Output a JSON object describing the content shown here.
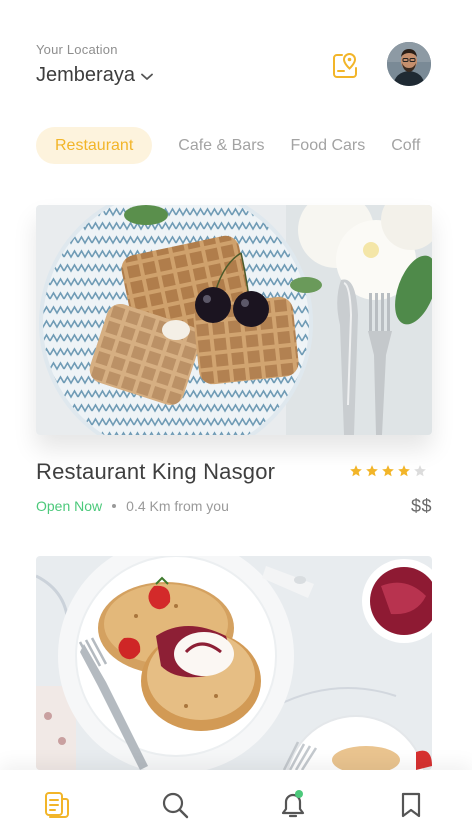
{
  "header": {
    "location_label": "Your Location",
    "location_value": "Jemberaya"
  },
  "tabs": [
    {
      "label": "Restaurant",
      "active": true
    },
    {
      "label": "Cafe & Bars",
      "active": false
    },
    {
      "label": "Food Cars",
      "active": false
    },
    {
      "label": "Coff",
      "active": false
    }
  ],
  "restaurants": [
    {
      "name": "Restaurant King Nasgor",
      "rating": 4,
      "rating_max": 5,
      "status": "Open Now",
      "distance": "0.4 Km from you",
      "price": "$$"
    }
  ],
  "colors": {
    "accent": "#f2b529",
    "accent_bg": "#fdf3dd",
    "open_green": "#4cc97b",
    "star_empty": "#dcdcdc"
  },
  "icons": {
    "header": [
      "chevron-down-icon",
      "map-pin-icon",
      "avatar"
    ],
    "nav": [
      "menu-doc-icon",
      "search-icon",
      "bell-icon",
      "bookmark-icon"
    ]
  },
  "bottom_nav": {
    "active_index": 0,
    "notification_dot": true
  }
}
